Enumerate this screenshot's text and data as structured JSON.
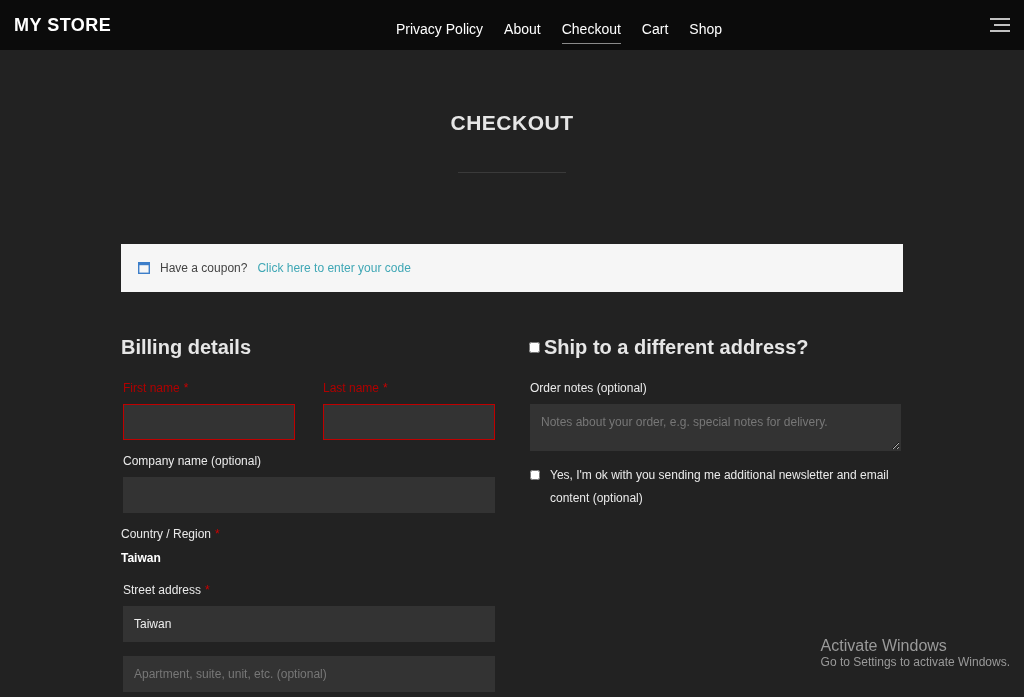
{
  "header": {
    "brand": "MY STORE",
    "nav": [
      {
        "label": "Privacy Policy",
        "selected": false
      },
      {
        "label": "About",
        "selected": false
      },
      {
        "label": "Checkout",
        "selected": true
      },
      {
        "label": "Cart",
        "selected": false
      },
      {
        "label": "Shop",
        "selected": false
      }
    ]
  },
  "page_title": "CHECKOUT",
  "coupon": {
    "text": "Have a coupon?",
    "link": "Click here to enter your code"
  },
  "required_mark": "*",
  "billing": {
    "title": "Billing details",
    "name_fields": [
      {
        "kind": "input",
        "label": "First name",
        "required": true,
        "error": true
      },
      {
        "kind": "input",
        "label": "Last name",
        "required": true,
        "error": true
      }
    ],
    "fields": [
      {
        "kind": "input",
        "label": "Company name (optional)",
        "required": false,
        "error": false
      },
      {
        "kind": "static",
        "label": "Country / Region",
        "required": true,
        "value": "Taiwan"
      },
      {
        "kind": "input",
        "label": "Street address",
        "required": true,
        "error": false,
        "value": "Taiwan"
      },
      {
        "kind": "input",
        "error": false,
        "placeholder": "Apartment, suite, unit, etc. (optional)"
      }
    ]
  },
  "shipping": {
    "title": "Ship to a different address?",
    "checked": false
  },
  "order_notes": {
    "label": "Order notes (optional)",
    "placeholder": "Notes about your order, e.g. special notes for delivery."
  },
  "newsletter": {
    "label": "Yes, I'm ok with you sending me additional newsletter and email content (optional)",
    "checked": false
  },
  "os_notice": {
    "title": "Activate Windows",
    "text": "Go to Settings to activate Windows."
  }
}
